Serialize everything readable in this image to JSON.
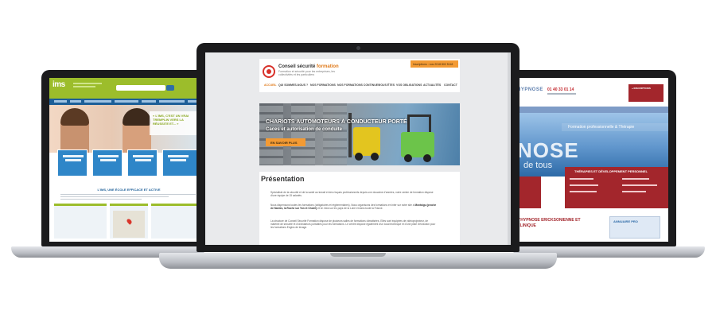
{
  "left_site": {
    "logo": "ims",
    "hero_quote": "« L'IMS, C'EST UN VRAI TREMPLIN VERS LA RÉUSSITE ET... »",
    "tiles": [
      "FORMATIONS COMMERCIALES",
      "FORMATIONS ASSISTANAT",
      "FORMATIONS GESTION",
      "FORMATIONS RH"
    ],
    "headline": "L'IMS, UNE ÉCOLE EFFICACE ET ACTIVE",
    "colors": {
      "brand_green": "#9cbd2b",
      "nav_blue": "#1d5f98",
      "tile_blue": "#2f86c8"
    }
  },
  "center_site": {
    "brand_name": "Conseil sécurité",
    "brand_accent": "formation",
    "brand_tagline": "Formation et sécurité pour les entreprises, les collectivités et les particuliers",
    "register_banner": "Inscriptions : nos 2018 802 5118",
    "nav": [
      "ACCUEIL",
      "QUI SOMMES-NOUS ?",
      "NOS FORMATIONS",
      "NOS FORMATIONS CONTINUES",
      "VOUS ÊTES",
      "VOS OBLIGATIONS",
      "ACTUALITÉS",
      "CONTACT"
    ],
    "active_nav": "ACCUEIL",
    "hero_title": "CHARIOTS AUTOMOTEURS À CONDUCTEUR PORTÉ",
    "hero_subtitle": "Caces et autorisation de conduite",
    "hero_button": "EN SAVOIR PLUS",
    "section_title": "Présentation",
    "paragraph_1": "Spécialiste de la sécurité et de la santé au travail et des risques professionnels depuis une douzaine d'années, notre centre de formation dispose d'une équipe de 15 salariés.",
    "paragraph_2_start": "Nous dispensons toutes les formations (obligatoires et réglementaires). Nous organisons des formations en inter sur notre site à ",
    "paragraph_2_bold": "Montaigu (proche de Nantes, la Roche sur Yon et Cholet)",
    "paragraph_2_end": " et en intra sur les pays de la Loire et dans toute la France.",
    "paragraph_3": "La structure de Conseil Sécurité Formation dispose de plusieurs salles de formations climatisées. Elles sont équipées de vidéoprojecteur, de matériel de sécurité et d'ordinateurs portables pour les formations. Le centre dispose également d'un local technique et d'une piste d'évolution pour les formations Engins de levage.",
    "colors": {
      "accent_orange": "#f39a33",
      "logo_red": "#d8322b"
    }
  },
  "right_site": {
    "logo": "HYPNOSE",
    "phone": "01 40 33 01 14",
    "red_box": "» INSCRIPTIONS",
    "banner_strip": "Formation professionnelle & Thérapie",
    "banner_big": "NOSE",
    "banner_small": "de tous",
    "card_title": "THÉRAPIES ET DÉVELOPPEMENT PERSONNEL",
    "footer_title": "L'HYPNOSE ERICKSONIENNE ET CLINIQUE",
    "side_box": "ANNUAIRE PRO",
    "colors": {
      "brand_red": "#a3262c",
      "sky_blue": "#5f95cc"
    }
  }
}
